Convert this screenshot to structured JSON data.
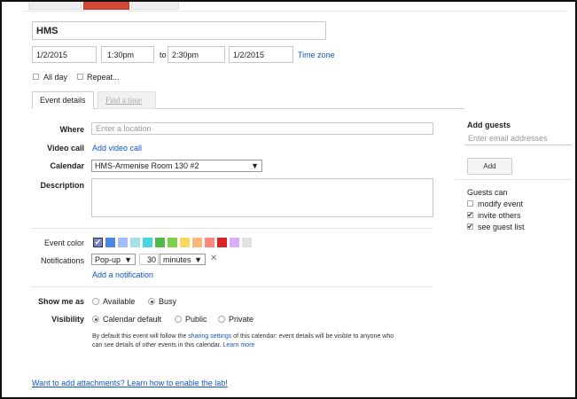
{
  "event": {
    "title": "HMS",
    "start_date": "1/2/2015",
    "start_time": "1:30pm",
    "to_label": "to",
    "end_time": "2:30pm",
    "end_date": "1/2/2015",
    "timezone_link": "Time zone",
    "all_day_label": "All day",
    "repeat_label": "Repeat..."
  },
  "tabs": [
    {
      "label": "Event details"
    },
    {
      "label": "Find a time"
    }
  ],
  "details": {
    "where_label": "Where",
    "where_placeholder": "Enter a location",
    "video_label": "Video call",
    "video_link": "Add video call",
    "calendar_label": "Calendar",
    "calendar_value": "HMS-Armenise Room 130 #2",
    "description_label": "Description",
    "color_label": "Event color",
    "notifications_label": "Notifications",
    "notif_type": "Pop-up",
    "notif_amount": "30",
    "notif_unit": "minutes",
    "add_notification_link": "Add a notification",
    "showme_label": "Show me as",
    "available_label": "Available",
    "busy_label": "Busy",
    "visibility_label": "Visibility",
    "vis_default_label": "Calendar default",
    "vis_public_label": "Public",
    "vis_private_label": "Private",
    "info_line1_a": "By default this event will follow the",
    "info_link_sharing": "sharing settings",
    "info_line1_b": "of this calendar: event details will be visible to anyone who",
    "info_line2": "can see details of other events in this calendar.",
    "info_link_learn": "Learn more"
  },
  "colors": [
    "#7986cb",
    "#4986e7",
    "#a4bdfc",
    "#9fe1e7",
    "#46d6db",
    "#51b749",
    "#7bd148",
    "#fbd75b",
    "#ffb878",
    "#ff887c",
    "#dc2127",
    "#dbadff",
    "#e1e1e1"
  ],
  "guests": {
    "heading": "Add guests",
    "email_placeholder": "Enter email addresses",
    "add_button": "Add",
    "can_label": "Guests can",
    "opt_modify": "modify event",
    "opt_invite": "invite others",
    "opt_see": "see guest list"
  },
  "footer": {
    "attachments_link": "Want to add attachments? Learn how to enable the lab!"
  }
}
